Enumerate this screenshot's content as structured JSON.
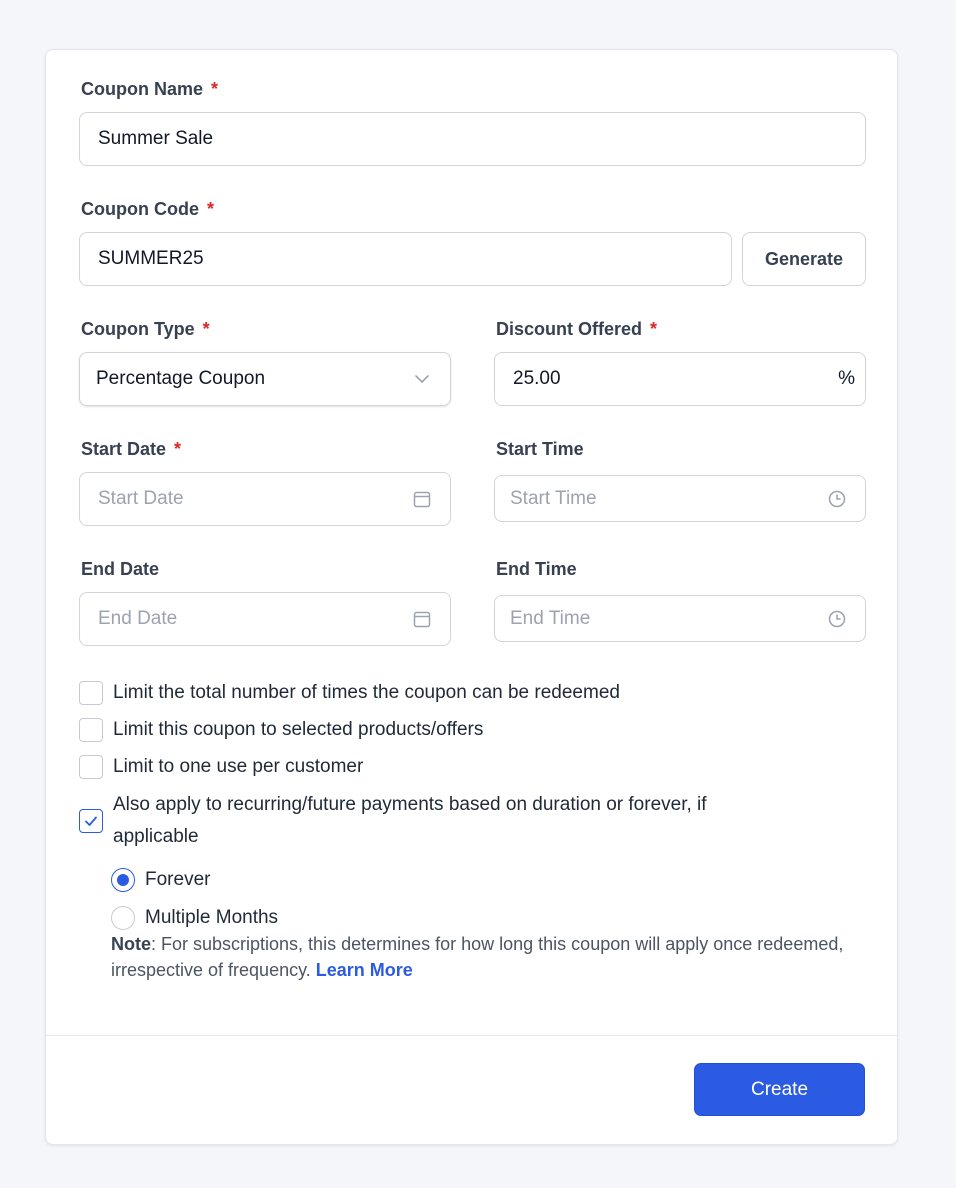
{
  "form": {
    "coupon_name": {
      "label": "Coupon Name",
      "required_mark": "*",
      "value": "Summer Sale"
    },
    "coupon_code": {
      "label": "Coupon Code",
      "required_mark": "*",
      "value": "SUMMER25",
      "generate_label": "Generate"
    },
    "coupon_type": {
      "label": "Coupon Type",
      "required_mark": "*",
      "selected": "Percentage Coupon",
      "icon": "chevron-down-icon"
    },
    "discount": {
      "label": "Discount Offered",
      "required_mark": "*",
      "value": "25.00",
      "suffix": "%"
    },
    "start_date": {
      "label": "Start Date",
      "required_mark": "*",
      "placeholder": "Start Date",
      "icon": "calendar-icon"
    },
    "start_time": {
      "label": "Start Time",
      "placeholder": "Start Time",
      "icon": "clock-icon"
    },
    "end_date": {
      "label": "End Date",
      "placeholder": "End Date",
      "icon": "calendar-icon"
    },
    "end_time": {
      "label": "End Time",
      "placeholder": "End Time",
      "icon": "clock-icon"
    },
    "options": [
      {
        "label": "Limit the total number of times the coupon can be redeemed",
        "checked": false
      },
      {
        "label": "Limit this coupon to selected products/offers",
        "checked": false
      },
      {
        "label": "Limit to one use per customer",
        "checked": false
      },
      {
        "label": "Also apply to recurring/future payments based on duration or forever, if applicable",
        "checked": true
      }
    ],
    "duration": {
      "options": [
        {
          "label": "Forever",
          "selected": true
        },
        {
          "label": "Multiple Months",
          "selected": false
        }
      ],
      "note_prefix": "Note",
      "note_text": ": For subscriptions, this determines for how long this coupon will apply once redeemed, irrespective of frequency. ",
      "learn_more": "Learn More"
    },
    "submit_label": "Create"
  },
  "colors": {
    "accent": "#2b5be3",
    "required": "#dc2626",
    "background": "#f4f6f9"
  }
}
